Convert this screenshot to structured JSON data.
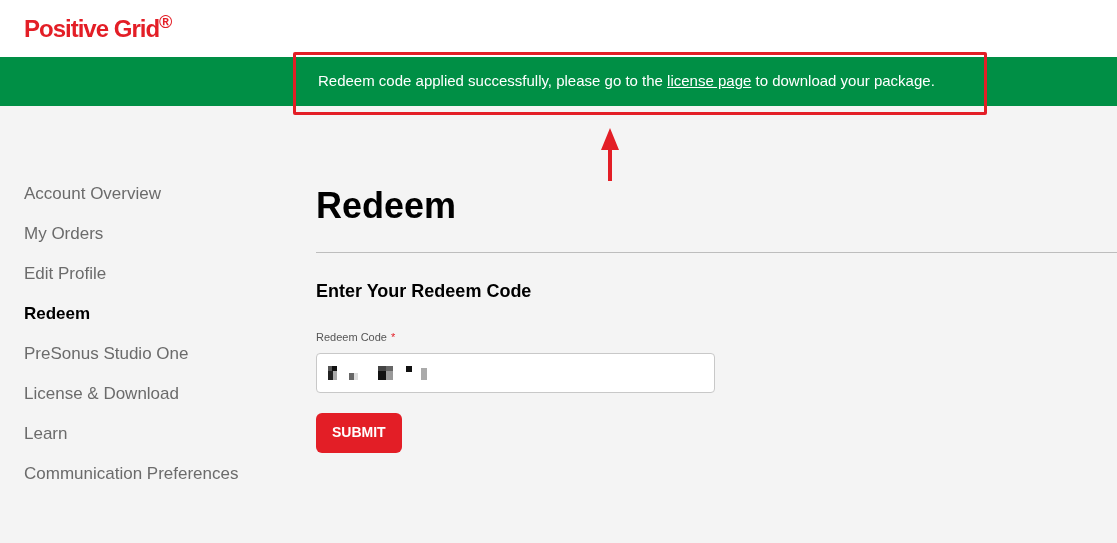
{
  "logo": "Positive Grid$^{®}$",
  "banner": {
    "text_before": "Redeem code applied successfully, please go to the",
    "link": "license page",
    "text_after": "to download your package."
  },
  "sidebar": {
    "items": [
      {
        "label": "Account Overview",
        "selected": false
      },
      {
        "label": "My Orders",
        "selected": false
      },
      {
        "label": "Edit Profile",
        "selected": false
      },
      {
        "label": "Redeem",
        "selected": true
      },
      {
        "label": "PreSonus Studio One",
        "selected": false
      },
      {
        "label": "License & Download",
        "selected": false
      },
      {
        "label": "Learn",
        "selected": false
      },
      {
        "label": "Communication Preferences",
        "selected": false
      }
    ]
  },
  "main": {
    "title": "Redeem",
    "section_title": "Enter Your Redeem Code",
    "field": {
      "label": "Redeem Code",
      "required_mark": "*"
    },
    "submit_button": "SUBMIT"
  }
}
